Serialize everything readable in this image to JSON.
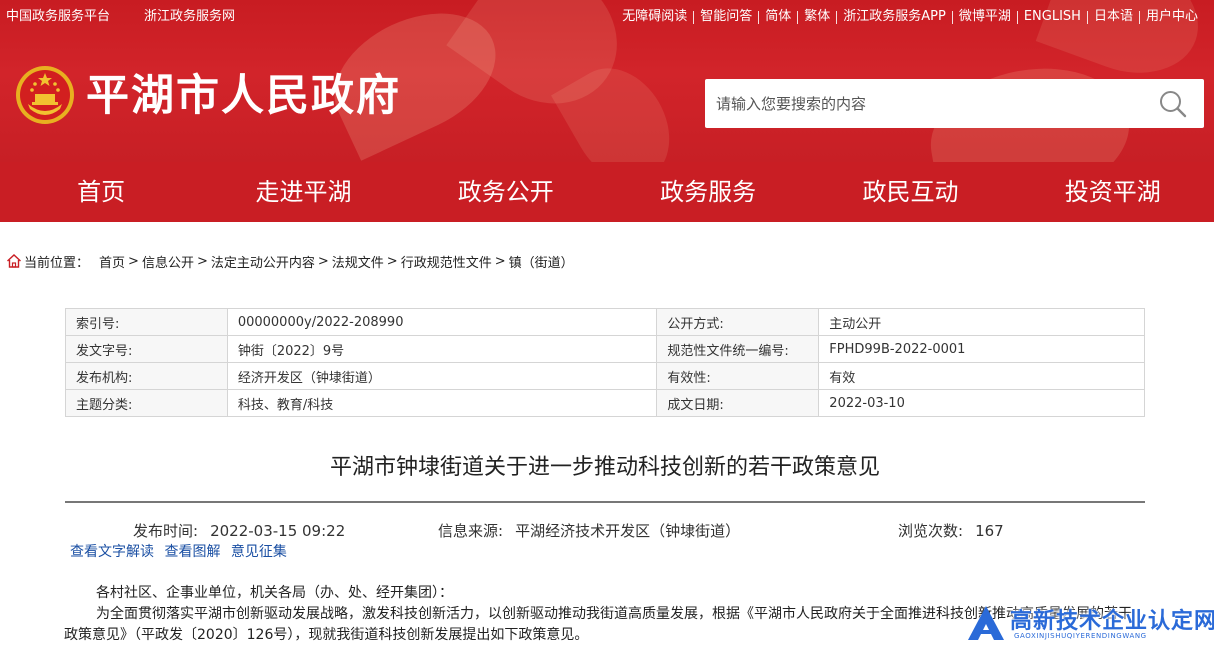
{
  "colors": {
    "brand_red": "#c91e24",
    "link_blue": "#1a4fa3",
    "watermark_blue": "#2a6ad8"
  },
  "topbar": {
    "left_links": [
      "中国政务服务平台",
      "浙江政务服务网"
    ],
    "right_links": [
      "无障碍阅读",
      "智能问答",
      "简体",
      "繁体",
      "浙江政务服务APP",
      "微博平湖",
      "ENGLISH",
      "日本语",
      "用户中心"
    ]
  },
  "header": {
    "emblem_icon": "national-emblem-icon",
    "title": "平湖市人民政府",
    "search_placeholder": "请输入您要搜索的内容",
    "search_icon": "search-icon"
  },
  "nav": [
    "首页",
    "走进平湖",
    "政务公开",
    "政务服务",
    "政民互动",
    "投资平湖"
  ],
  "breadcrumb": {
    "icon": "home-icon",
    "label": "当前位置：",
    "items": [
      "首页",
      "信息公开",
      "法定主动公开内容",
      "法规文件",
      "行政规范性文件",
      "镇（街道）"
    ]
  },
  "meta": {
    "rows": [
      {
        "k1": "索引号:",
        "v1": "00000000y/2022-208990",
        "k2": "公开方式:",
        "v2": "主动公开"
      },
      {
        "k1": "发文字号:",
        "v1": "钟街〔2022〕9号",
        "k2": "规范性文件统一编号:",
        "v2": "FPHD99B-2022-0001"
      },
      {
        "k1": "发布机构:",
        "v1": "经济开发区（钟埭街道）",
        "k2": "有效性:",
        "v2": "有效"
      },
      {
        "k1": "主题分类:",
        "v1": "科技、教育/科技",
        "k2": "成文日期:",
        "v2": "2022-03-10"
      }
    ]
  },
  "article": {
    "title": "平湖市钟埭街道关于进一步推动科技创新的若干政策意见",
    "publish_label": "发布时间:",
    "publish_time": "2022-03-15 09:22",
    "source_label": "信息来源:",
    "source": "平湖经济技术开发区（钟埭街道）",
    "views_label": "浏览次数:",
    "views": "167",
    "links": [
      "查看文字解读",
      "查看图解",
      "意见征集"
    ],
    "para1": "各村社区、企事业单位，机关各局（办、处、经开集团）：",
    "para2": "为全面贯彻落实平湖市创新驱动发展战略，激发科技创新活力，以创新驱动推动我街道高质量发展，根据《平湖市人民政府关于全面推进科技创新推动高质量发展的若干政策意见》（平政发〔2020〕126号），现就我街道科技创新发展提出如下政策意见。"
  },
  "watermark": {
    "cn": "高新技术企业认定网",
    "en": "GAOXINJISHUQIYERENDINGWANG"
  }
}
